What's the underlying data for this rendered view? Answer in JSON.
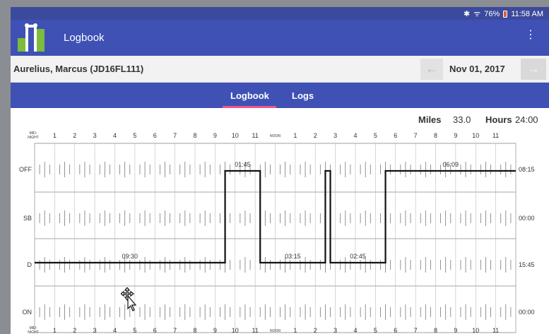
{
  "status_bar": {
    "icons": [
      "bluetooth-icon",
      "wifi-icon",
      "battery-icon"
    ],
    "battery": "76%",
    "time": "11:58 AM"
  },
  "app_bar": {
    "title": "Logbook",
    "menu_icon": "more-vert-icon"
  },
  "driver_bar": {
    "driver": "Aurelius, Marcus (JD16FL111)",
    "date": "Nov 01, 2017",
    "prev_icon": "arrow-left-icon",
    "next_icon": "arrow-right-icon"
  },
  "tabs": [
    {
      "label": "Logbook",
      "selected": true
    },
    {
      "label": "Logs",
      "selected": false
    }
  ],
  "totals": {
    "miles_label": "Miles",
    "miles": "33.0",
    "hours_label": "Hours",
    "hours": "24:00"
  },
  "grid": {
    "rows": [
      {
        "label": "OFF",
        "total": "08:15"
      },
      {
        "label": "SB",
        "total": "00:00"
      },
      {
        "label": "D",
        "total": "15:45"
      },
      {
        "label": "ON",
        "total": "00:00"
      }
    ],
    "hour_labels": [
      "MID-NIGHT",
      "1",
      "2",
      "3",
      "4",
      "5",
      "6",
      "7",
      "8",
      "9",
      "10",
      "11",
      "NOON",
      "1",
      "2",
      "3",
      "4",
      "5",
      "6",
      "7",
      "8",
      "9",
      "10",
      "11"
    ],
    "midnight_top": "MID-",
    "midnight_bottom": "NIGHT",
    "noon": "NOON",
    "segments": [
      {
        "status": "D",
        "start_hour": 0.0,
        "end_hour": 9.5,
        "duration": "09:30"
      },
      {
        "status": "OFF",
        "start_hour": 9.5,
        "end_hour": 11.25,
        "duration": "01:45"
      },
      {
        "status": "D",
        "start_hour": 11.25,
        "end_hour": 14.5,
        "duration": "03:15"
      },
      {
        "status": "OFF",
        "start_hour": 14.5,
        "end_hour": 14.75,
        "duration": ""
      },
      {
        "status": "D",
        "start_hour": 14.75,
        "end_hour": 17.5,
        "duration": "02:45"
      },
      {
        "status": "OFF",
        "start_hour": 17.5,
        "end_hour": 24.0,
        "duration": "06:09"
      }
    ],
    "colors": {
      "line": "#111111",
      "grid": "#888888"
    }
  }
}
